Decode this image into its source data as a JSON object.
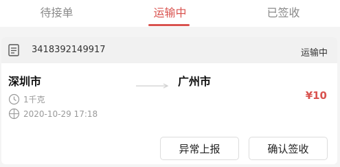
{
  "tabs": [
    {
      "label": "待接单"
    },
    {
      "label": "运输中"
    },
    {
      "label": "已签收"
    }
  ],
  "active_tab_color": "#d9534f",
  "order": {
    "number": "3418392149917",
    "status": "运输中",
    "from_city": "深圳市",
    "to_city": "广州市",
    "weight": "1千克",
    "datetime": "2020-10-29 17:18",
    "price": "¥10"
  },
  "actions": {
    "report_label": "异常上报",
    "confirm_label": "确认签收"
  },
  "icons": {
    "order": "document-icon",
    "weight": "clock-icon",
    "time": "calendar-clock-icon"
  }
}
